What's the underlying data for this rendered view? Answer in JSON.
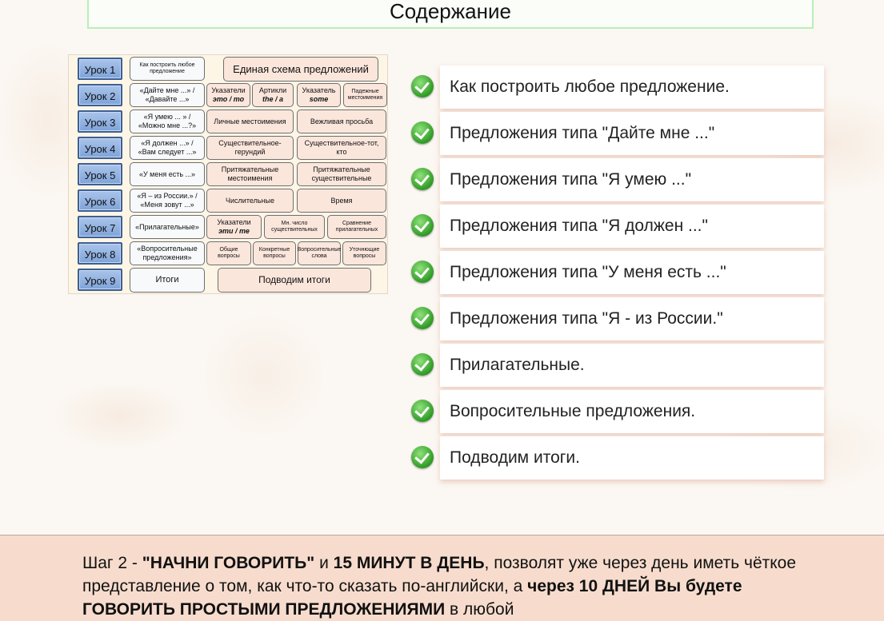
{
  "header": {
    "title": "Содержание"
  },
  "diagram": {
    "lessons": [
      "Урок 1",
      "Урок 2",
      "Урок 3",
      "Урок 4",
      "Урок 5",
      "Урок 6",
      "Урок 7",
      "Урок 8",
      "Урок 9"
    ],
    "cells": {
      "r1a": "Как построить любое предложение",
      "r1b": "Единая схема предложений",
      "r2a": "«Дайте мне ...» / «Давайте ...»",
      "r2b1": "Указатели",
      "r2b2": "это / то",
      "r2c1": "Артикли",
      "r2c2": "the / a",
      "r2d1": "Указатель",
      "r2d2": "some",
      "r2e": "Падежные местоимения",
      "r3a": "«Я умею ... » / «Можно мне ...?»",
      "r3b": "Личные местоимения",
      "r3c": "Вежливая просьба",
      "r4a": "«Я должен ...» / «Вам следует ...»",
      "r4b": "Существительное-герундий",
      "r4c": "Существительное-тот, кто",
      "r5a": "«У меня есть ...»",
      "r5b": "Притяжательные местоимения",
      "r5c": "Притяжательные существительные",
      "r6a": "«Я – из России.» / «Меня зовут ...»",
      "r6b": "Числительные",
      "r6c": "Время",
      "r7a": "«Прилагательные»",
      "r7b1": "Указатели",
      "r7b2": "эти / те",
      "r7c": "Мн. число существительных",
      "r7d": "Сравнение прилагательных",
      "r8a": "«Вопросительные предложения»",
      "r8b": "Общие вопросы",
      "r8c": "Конкретные вопросы",
      "r8d": "Вопросительные слова",
      "r8e": "Уточнющие вопросы",
      "r9a": "Итоги",
      "r9b": "Подводим итоги"
    }
  },
  "contents": {
    "items": [
      "Как построить любое предложение.",
      "Предложения типа \"Дайте мне ...\"",
      "Предложения типа \"Я умею ...\"",
      "Предложения типа \"Я должен ...\"",
      "Предложения типа \"У меня есть ...\"",
      "Предложения типа \"Я - из России.\"",
      "Прилагательные.",
      "Вопросительные предложения.",
      "Подводим итоги."
    ]
  },
  "footer": {
    "p1": "Шаг 2 - ",
    "p2": "\"НАЧНИ ГОВОРИТЬ\"",
    "p3": " и ",
    "p4": "15 МИНУТ В ДЕНЬ",
    "p5": ", позволят уже через день иметь чёткое представление о том, как что-то сказать по-английски, а ",
    "p6": "через 10 ДНЕЙ Вы будете ГОВОРИТЬ ПРОСТЫМИ ПРЕДЛОЖЕНИЯМИ",
    "p7": " в любой"
  }
}
